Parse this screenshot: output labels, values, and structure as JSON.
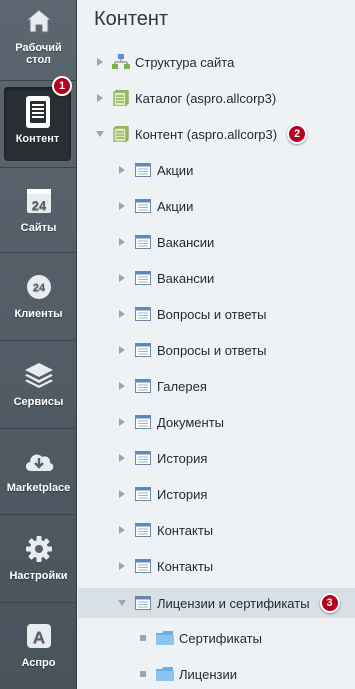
{
  "sidebar": {
    "items": [
      {
        "label": "Рабочий\nстол",
        "icon": "home-icon"
      },
      {
        "label": "Контент",
        "icon": "document-icon"
      },
      {
        "label": "Сайты",
        "icon": "calendar-24-icon"
      },
      {
        "label": "Клиенты",
        "icon": "clients-24-icon"
      },
      {
        "label": "Сервисы",
        "icon": "layers-icon"
      },
      {
        "label": "Marketplace",
        "icon": "cloud-download-icon"
      },
      {
        "label": "Настройки",
        "icon": "gear-icon"
      },
      {
        "label": "Аспро",
        "icon": "aspro-a-icon"
      }
    ],
    "badge": "1"
  },
  "content": {
    "title": "Контент",
    "tree": [
      {
        "label": "Структура сайта",
        "icon": "site-structure-icon"
      },
      {
        "label": "Каталог (aspro.allcorp3)",
        "icon": "catalog-icon"
      },
      {
        "label": "Контент (aspro.allcorp3)",
        "icon": "catalog-icon",
        "badge": "2"
      },
      {
        "label": "Акции",
        "icon": "iblock-icon"
      },
      {
        "label": "Акции",
        "icon": "iblock-icon"
      },
      {
        "label": "Вакансии",
        "icon": "iblock-icon"
      },
      {
        "label": "Вакансии",
        "icon": "iblock-icon"
      },
      {
        "label": "Вопросы и ответы",
        "icon": "iblock-icon"
      },
      {
        "label": "Вопросы и ответы",
        "icon": "iblock-icon"
      },
      {
        "label": "Галерея",
        "icon": "iblock-icon"
      },
      {
        "label": "Документы",
        "icon": "iblock-icon"
      },
      {
        "label": "История",
        "icon": "iblock-icon"
      },
      {
        "label": "История",
        "icon": "iblock-icon"
      },
      {
        "label": "Контакты",
        "icon": "iblock-icon"
      },
      {
        "label": "Контакты",
        "icon": "iblock-icon"
      },
      {
        "label": "Лицензии и сертификаты",
        "icon": "iblock-icon",
        "badge": "3"
      },
      {
        "label": "Сертификаты",
        "icon": "folder-icon"
      },
      {
        "label": "Лицензии",
        "icon": "folder-icon"
      }
    ]
  },
  "colors": {
    "badge": "#b4001e",
    "selected_row": "#d8e0e6",
    "sidebar": "#55606a"
  }
}
